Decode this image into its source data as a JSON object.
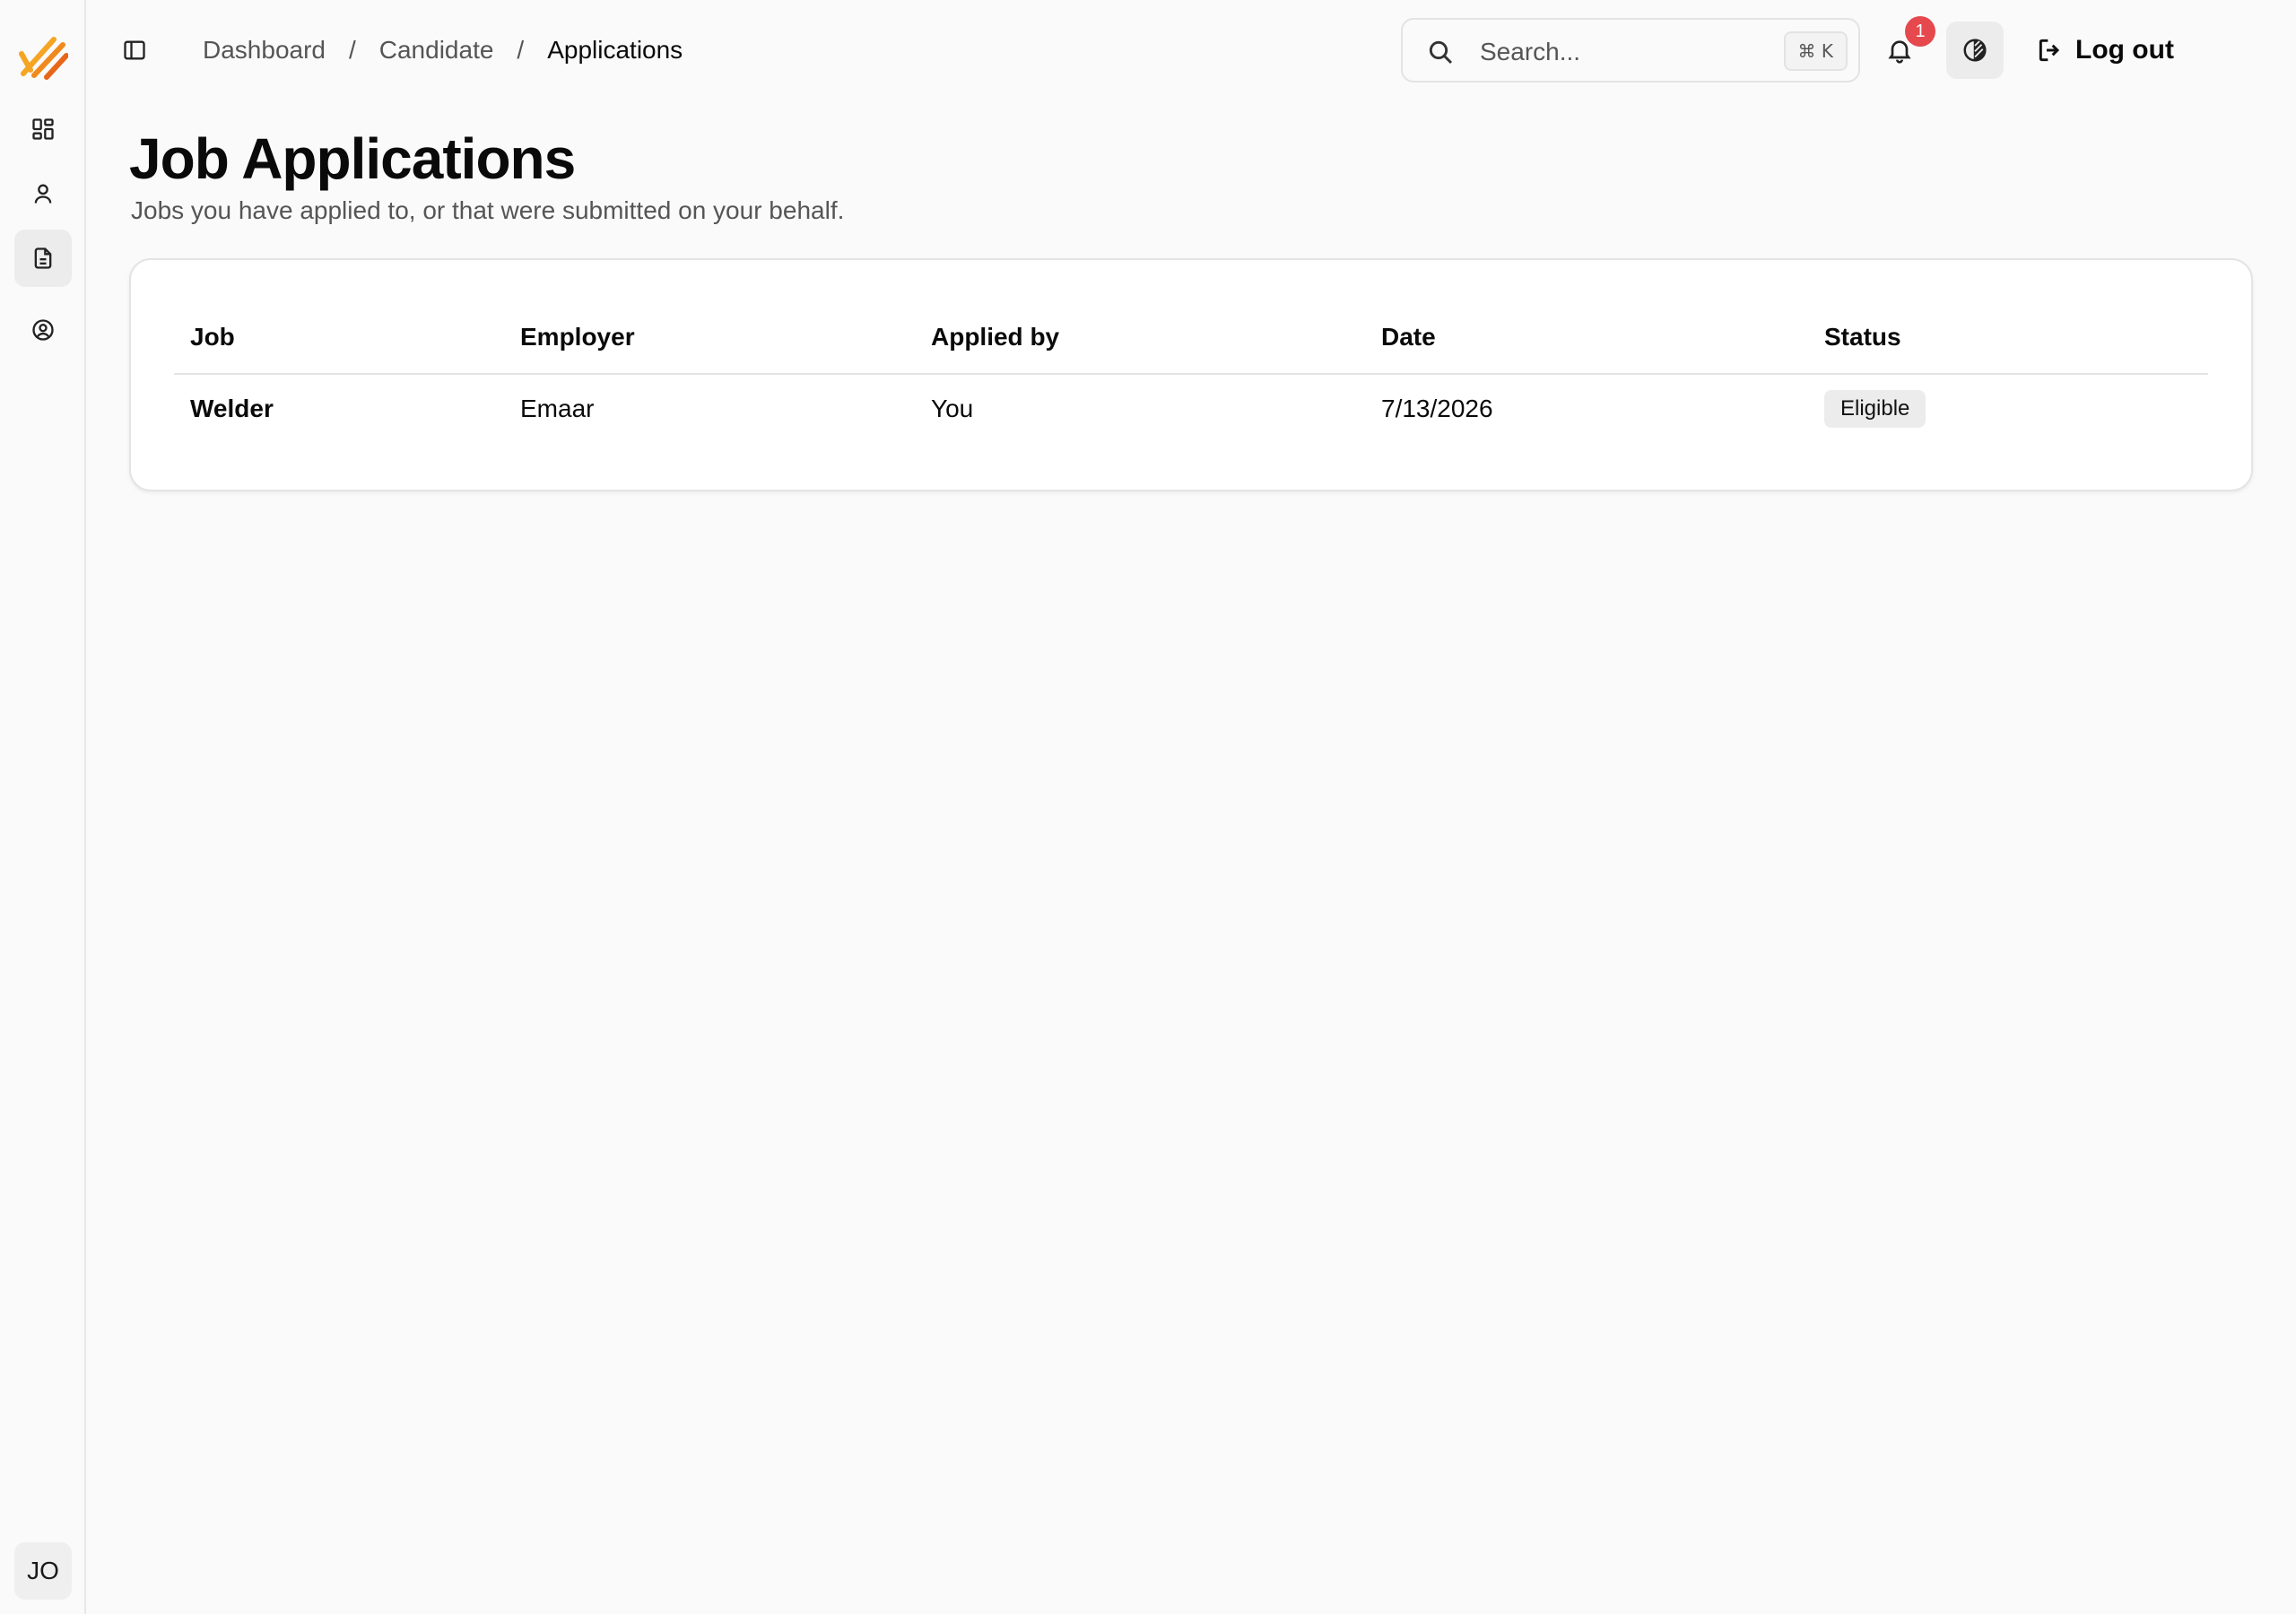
{
  "breadcrumb": {
    "items": [
      "Dashboard",
      "Candidate",
      "Applications"
    ],
    "separator": "/"
  },
  "search": {
    "placeholder": "Search...",
    "shortcut": "⌘ K"
  },
  "notifications": {
    "count": "1"
  },
  "header": {
    "logout_label": "Log out"
  },
  "user": {
    "initials": "JO"
  },
  "page": {
    "title": "Job Applications",
    "subtitle": "Jobs you have applied to, or that were submitted on your behalf."
  },
  "table": {
    "columns": [
      "Job",
      "Employer",
      "Applied by",
      "Date",
      "Status"
    ],
    "rows": [
      {
        "job": "Welder",
        "employer": "Emaar",
        "applied_by": "You",
        "date": "7/13/2026",
        "status": "Eligible"
      }
    ]
  },
  "colors": {
    "accent": "#f5a524",
    "badge_red": "#e5484d"
  },
  "icons": {
    "logo": "brand-stripes-logo",
    "nav": [
      "dashboard-icon",
      "user-icon",
      "document-icon",
      "user-circle-icon"
    ],
    "toggle": "sidebar-toggle-icon",
    "search": "search-icon",
    "bell": "bell-icon",
    "theme": "contrast-icon",
    "logout": "logout-icon"
  }
}
